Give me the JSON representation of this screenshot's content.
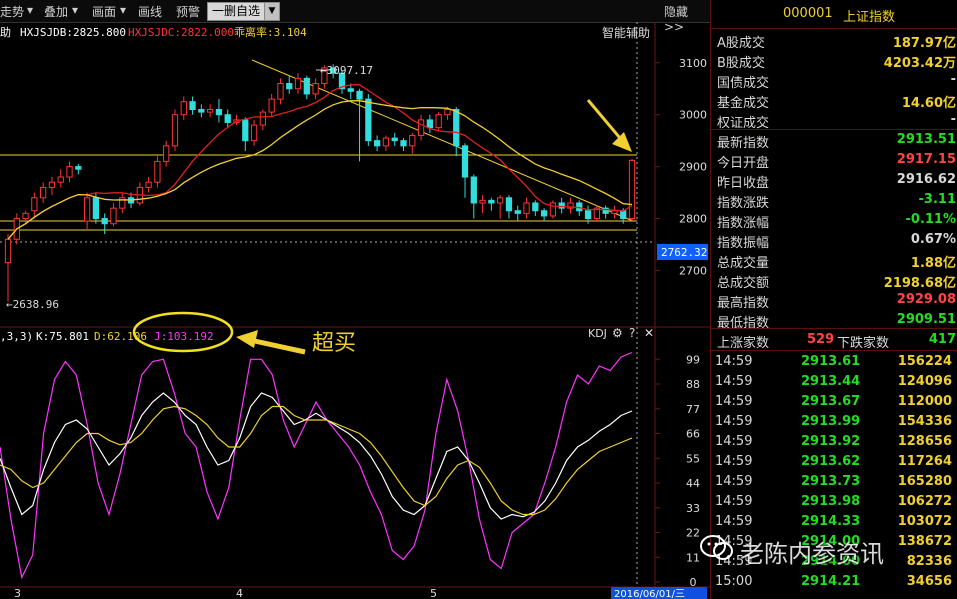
{
  "toolbar": {
    "items": [
      "走势",
      "叠加",
      "画面",
      "画线",
      "预警"
    ],
    "selected_button": "一删自选",
    "hide_label": "隐藏"
  },
  "price_panel": {
    "ma_labels": [
      {
        "text": "助",
        "color": "#ffffff"
      },
      {
        "text": "HXJSJDB:2825.800",
        "color": "#ffffff"
      },
      {
        "text": "HXJSJDC:2822.000",
        "color": "#ff3333"
      },
      {
        "text": "乖离率:3.104",
        "color": "#f0d030"
      }
    ],
    "assist_label": "智能辅助",
    "high_label": "3097.17",
    "low_label": "2638.96",
    "current_price_box": "2762.32",
    "y_ticks": [
      "3100",
      "3000",
      "2900",
      "2800",
      "2700"
    ]
  },
  "kdj_panel": {
    "labels": [
      {
        "text": ",3,3)",
        "color": "#ffffff"
      },
      {
        "text": "K:75.801",
        "color": "#ffffff"
      },
      {
        "text": "D:62.106",
        "color": "#f0d030"
      },
      {
        "text": "J:103.192",
        "color": "#ff33ff"
      }
    ],
    "name": "KDJ",
    "annotation": "超买",
    "y_ticks": [
      "99",
      "88",
      "77",
      "66",
      "55",
      "44",
      "33",
      "22",
      "11",
      "0"
    ]
  },
  "x_axis": {
    "labels": [
      "3",
      "4",
      "5"
    ],
    "date_label": "2016/06/01/三"
  },
  "right_panel": {
    "code": "000001",
    "name": "上证指数",
    "stats": [
      {
        "label": "A股成交",
        "value": "187.97亿",
        "color": "#f0d030"
      },
      {
        "label": "B股成交",
        "value": "4203.42万",
        "color": "#f0d030"
      },
      {
        "label": "国债成交",
        "value": "-",
        "color": "#d8d8d8"
      },
      {
        "label": "基金成交",
        "value": "14.60亿",
        "color": "#f0d030"
      },
      {
        "label": "权证成交",
        "value": "-",
        "color": "#d8d8d8"
      },
      {
        "label": "最新指数",
        "value": "2913.51",
        "color": "#22dd22"
      },
      {
        "label": "今日开盘",
        "value": "2917.15",
        "color": "#ff4444"
      },
      {
        "label": "昨日收盘",
        "value": "2916.62",
        "color": "#d8d8d8"
      },
      {
        "label": "指数涨跌",
        "value": "-3.11",
        "color": "#22dd22"
      },
      {
        "label": "指数涨幅",
        "value": "-0.11%",
        "color": "#22dd22"
      },
      {
        "label": "指数振幅",
        "value": "0.67%",
        "color": "#d8d8d8"
      },
      {
        "label": "总成交量",
        "value": "1.88亿",
        "color": "#f0d030"
      },
      {
        "label": "总成交额",
        "value": "2198.68亿",
        "color": "#f0d030"
      },
      {
        "label": "最高指数",
        "value": "2929.08",
        "color": "#ff4444"
      },
      {
        "label": "最低指数",
        "value": "2909.51",
        "color": "#22dd22"
      }
    ],
    "breadth": {
      "up_label": "上涨家数",
      "up_value": "529",
      "down_label": "下跌家数",
      "down_value": "417"
    },
    "ticks": [
      {
        "time": "14:59",
        "price": "2913.61",
        "vol": "156224"
      },
      {
        "time": "14:59",
        "price": "2913.44",
        "vol": "124096"
      },
      {
        "time": "14:59",
        "price": "2913.67",
        "vol": "112000"
      },
      {
        "time": "14:59",
        "price": "2913.99",
        "vol": "154336"
      },
      {
        "time": "14:59",
        "price": "2913.92",
        "vol": "128656"
      },
      {
        "time": "14:59",
        "price": "2913.62",
        "vol": "117264"
      },
      {
        "time": "14:59",
        "price": "2913.73",
        "vol": "165280"
      },
      {
        "time": "14:59",
        "price": "2913.98",
        "vol": "106272"
      },
      {
        "time": "14:59",
        "price": "2914.33",
        "vol": "103072"
      },
      {
        "time": "14:59",
        "price": "2914.00",
        "vol": "138672"
      },
      {
        "time": "14:59",
        "price": "2914.00",
        "vol": "82336"
      },
      {
        "time": "15:00",
        "price": "2914.21",
        "vol": "34656"
      }
    ]
  },
  "watermark": {
    "text": "老陈内参资讯"
  },
  "chart_data": {
    "type": "candlestick",
    "ylim": [
      2620,
      3140
    ],
    "candles": [
      [
        2715,
        2760,
        2640,
        2770
      ],
      [
        2760,
        2800,
        2750,
        2810
      ],
      [
        2800,
        2810,
        2790,
        2815
      ],
      [
        2815,
        2840,
        2800,
        2850
      ],
      [
        2840,
        2860,
        2830,
        2870
      ],
      [
        2860,
        2870,
        2845,
        2880
      ],
      [
        2870,
        2880,
        2860,
        2895
      ],
      [
        2880,
        2900,
        2870,
        2910
      ],
      [
        2900,
        2895,
        2885,
        2905
      ],
      [
        2795,
        2840,
        2780,
        2850
      ],
      [
        2840,
        2800,
        2790,
        2850
      ],
      [
        2800,
        2790,
        2770,
        2810
      ],
      [
        2790,
        2820,
        2785,
        2830
      ],
      [
        2820,
        2840,
        2810,
        2850
      ],
      [
        2840,
        2830,
        2820,
        2850
      ],
      [
        2830,
        2860,
        2825,
        2870
      ],
      [
        2860,
        2870,
        2850,
        2880
      ],
      [
        2870,
        2910,
        2860,
        2920
      ],
      [
        2910,
        2940,
        2900,
        2950
      ],
      [
        2940,
        3000,
        2930,
        3010
      ],
      [
        3000,
        3025,
        2990,
        3035
      ],
      [
        3025,
        3010,
        3000,
        3035
      ],
      [
        3010,
        3005,
        2995,
        3020
      ],
      [
        3005,
        3010,
        2995,
        3020
      ],
      [
        3010,
        3000,
        2985,
        3030
      ],
      [
        3000,
        2985,
        2975,
        3010
      ],
      [
        2985,
        2990,
        2980,
        3000
      ],
      [
        2990,
        2950,
        2930,
        2995
      ],
      [
        2950,
        2980,
        2940,
        2990
      ],
      [
        2980,
        3005,
        2970,
        3010
      ],
      [
        3005,
        3030,
        2995,
        3040
      ],
      [
        3030,
        3060,
        3020,
        3070
      ],
      [
        3060,
        3050,
        3040,
        3075
      ],
      [
        3050,
        3070,
        3040,
        3080
      ],
      [
        3070,
        3040,
        3030,
        3075
      ],
      [
        3040,
        3060,
        3030,
        3070
      ],
      [
        3060,
        3090,
        3050,
        3095
      ],
      [
        3090,
        3080,
        3070,
        3097
      ],
      [
        3080,
        3050,
        3040,
        3085
      ],
      [
        3050,
        3045,
        3030,
        3060
      ],
      [
        3045,
        3030,
        2910,
        3050
      ],
      [
        3030,
        2950,
        2940,
        3040
      ],
      [
        2950,
        2940,
        2930,
        2960
      ],
      [
        2940,
        2955,
        2930,
        2960
      ],
      [
        2955,
        2950,
        2940,
        2965
      ],
      [
        2950,
        2940,
        2930,
        2955
      ],
      [
        2940,
        2960,
        2925,
        2965
      ],
      [
        2960,
        2990,
        2950,
        3000
      ],
      [
        2990,
        2975,
        2965,
        3000
      ],
      [
        2975,
        3000,
        2970,
        3005
      ],
      [
        3000,
        3010,
        2990,
        3015
      ],
      [
        3010,
        2940,
        2920,
        3015
      ],
      [
        2940,
        2880,
        2840,
        2945
      ],
      [
        2880,
        2830,
        2800,
        2885
      ],
      [
        2830,
        2835,
        2810,
        2845
      ],
      [
        2835,
        2830,
        2815,
        2840
      ],
      [
        2830,
        2840,
        2800,
        2845
      ],
      [
        2840,
        2815,
        2800,
        2845
      ],
      [
        2815,
        2810,
        2795,
        2825
      ],
      [
        2810,
        2830,
        2800,
        2840
      ],
      [
        2830,
        2815,
        2805,
        2835
      ],
      [
        2815,
        2805,
        2795,
        2820
      ],
      [
        2805,
        2830,
        2800,
        2835
      ],
      [
        2830,
        2820,
        2810,
        2840
      ],
      [
        2820,
        2830,
        2810,
        2840
      ],
      [
        2830,
        2815,
        2805,
        2835
      ],
      [
        2815,
        2800,
        2790,
        2825
      ],
      [
        2800,
        2820,
        2795,
        2825
      ],
      [
        2820,
        2810,
        2800,
        2825
      ],
      [
        2810,
        2815,
        2800,
        2825
      ],
      [
        2815,
        2800,
        2790,
        2820
      ],
      [
        2800,
        2912,
        2795,
        2915
      ]
    ],
    "k": [
      55,
      42,
      30,
      34,
      50,
      62,
      70,
      72,
      68,
      60,
      52,
      57,
      64,
      74,
      80,
      84,
      80,
      74,
      70,
      60,
      52,
      54,
      64,
      78,
      84,
      82,
      76,
      70,
      72,
      75,
      72,
      69,
      66,
      62,
      56,
      48,
      38,
      32,
      30,
      34,
      46,
      58,
      60,
      54,
      44,
      33,
      28,
      30,
      29,
      31,
      36,
      44,
      54,
      60,
      63,
      67,
      70,
      74,
      76
    ],
    "d": [
      52,
      50,
      45,
      42,
      44,
      50,
      56,
      62,
      66,
      66,
      63,
      61,
      62,
      66,
      72,
      77,
      78,
      77,
      74,
      70,
      64,
      60,
      60,
      66,
      74,
      78,
      78,
      74,
      72,
      72,
      72,
      70,
      68,
      66,
      62,
      56,
      49,
      42,
      36,
      34,
      38,
      46,
      52,
      54,
      51,
      44,
      36,
      32,
      30,
      30,
      32,
      37,
      44,
      50,
      54,
      58,
      60,
      62,
      64
    ],
    "j": [
      60,
      28,
      2,
      12,
      66,
      90,
      98,
      92,
      70,
      44,
      30,
      48,
      70,
      92,
      98,
      99,
      84,
      66,
      60,
      40,
      28,
      42,
      72,
      99,
      99,
      92,
      72,
      60,
      70,
      80,
      72,
      66,
      60,
      52,
      40,
      30,
      14,
      10,
      16,
      32,
      66,
      90,
      76,
      54,
      28,
      10,
      6,
      22,
      26,
      30,
      44,
      60,
      80,
      92,
      88,
      96,
      94,
      100,
      102
    ]
  }
}
